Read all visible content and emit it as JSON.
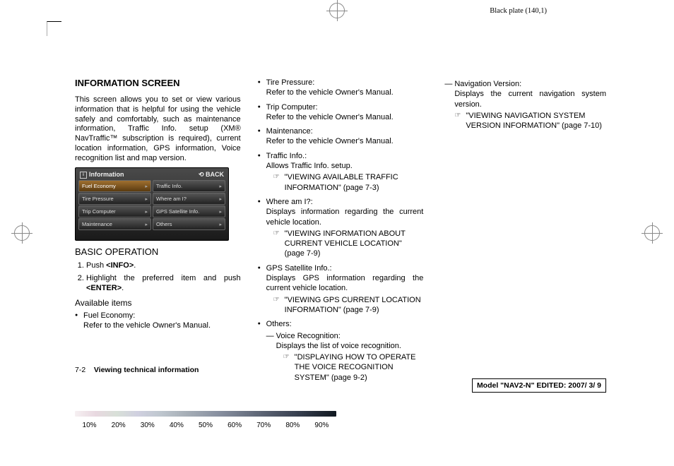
{
  "plate_info": "Black plate (140,1)",
  "section_title": "INFORMATION SCREEN",
  "intro": "This screen allows you to set or view various information that is helpful for using the vehicle safely and comfortably, such as maintenance information, Traffic Info. setup (XM® NavTraffic™ subscription is required), current location information, GPS information, Voice recognition list and map version.",
  "screenshot": {
    "title": "Information",
    "back": "BACK",
    "left": [
      "Fuel Economy",
      "Tire Pressure",
      "Trip Computer",
      "Maintenance"
    ],
    "right": [
      "Traffic Info.",
      "Where am I?",
      "GPS Satellite Info.",
      "Others"
    ]
  },
  "basic_operation_head": "BASIC OPERATION",
  "steps": [
    "Push <INFO>.",
    "Highlight the preferred item and push <ENTER>."
  ],
  "available_head": "Available items",
  "col1_items": [
    {
      "title": "Fuel Economy:",
      "body": "Refer to the vehicle Owner's Manual."
    }
  ],
  "col2_items": [
    {
      "title": "Tire Pressure:",
      "body": "Refer to the vehicle Owner's Manual."
    },
    {
      "title": "Trip Computer:",
      "body": "Refer to the vehicle Owner's Manual."
    },
    {
      "title": "Maintenance:",
      "body": "Refer to the vehicle Owner's Manual."
    },
    {
      "title": "Traffic Info.:",
      "body": "Allows Traffic Info. setup.",
      "ref": "\"VIEWING AVAILABLE TRAFFIC INFORMATION\" (page 7-3)"
    },
    {
      "title": "Where am I?:",
      "body": "Displays information regarding the current vehicle location.",
      "ref": "\"VIEWING INFORMATION ABOUT CURRENT VEHICLE LOCATION\" (page 7-9)"
    },
    {
      "title": "GPS Satellite Info.:",
      "body": "Displays GPS information regarding the current vehicle location.",
      "ref": "\"VIEWING GPS CURRENT LOCATION INFORMATION\" (page 7-9)"
    },
    {
      "title": "Others:",
      "sub": [
        {
          "title": "Voice Recognition:",
          "body": "Displays the list of voice recognition.",
          "ref": "\"DISPLAYING HOW TO OPERATE THE VOICE RECOGNITION SYSTEM\" (page 9-2)"
        }
      ]
    }
  ],
  "col3_items": [
    {
      "sub": [
        {
          "title": "Navigation Version:",
          "body": "Displays the current navigation system version.",
          "ref": "\"VIEWING NAVIGATION SYSTEM VERSION INFORMATION\" (page 7-10)"
        }
      ]
    }
  ],
  "footer": {
    "page_section": "7-2",
    "page_title": "Viewing technical information",
    "model": "Model \"NAV2-N\" EDITED: 2007/ 3/ 9"
  },
  "grad_labels": [
    "10%",
    "20%",
    "30%",
    "40%",
    "50%",
    "60%",
    "70%",
    "80%",
    "90%"
  ]
}
